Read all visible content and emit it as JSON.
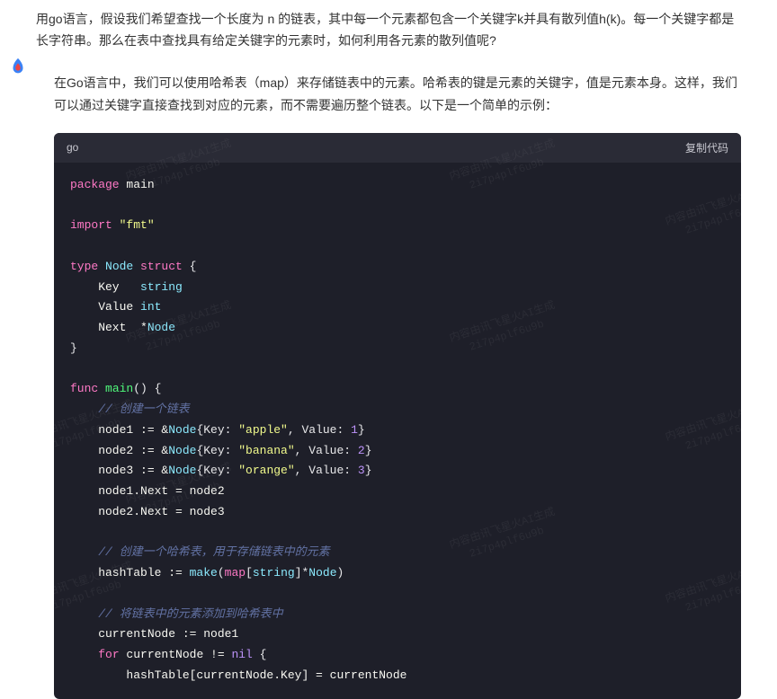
{
  "header": {
    "question": "用go语言，假设我们希望查找一个长度为 n 的链表，其中每一个元素都包含一个关键字k并具有散列值h(k)。每一个关键字都是长字符串。那么在表中查找具有给定关键字的元素时，如何利用各元素的散列值呢?"
  },
  "response": {
    "intro": "在Go语言中，我们可以使用哈希表（map）来存储链表中的元素。哈希表的键是元素的关键字，值是元素本身。这样，我们可以通过关键字直接查找到对应的元素，而不需要遍历整个链表。以下是一个简单的示例："
  },
  "code": {
    "lang": "go",
    "copy_label": "复制代码",
    "lines": {
      "l1_kw": "package",
      "l1_ident": " main",
      "l2_kw": "import",
      "l2_str": " \"fmt\"",
      "l3_kw": "type",
      "l3_name": " Node ",
      "l3_struct": "struct",
      "l3_brace": " {",
      "l4": "    Key   ",
      "l4_type": "string",
      "l5": "    Value ",
      "l5_type": "int",
      "l6": "    Next  *",
      "l6_type": "Node",
      "l7": "}",
      "l8_kw": "func",
      "l8_name": " main",
      "l8_paren": "() {",
      "l9_comment": "    // 创建一个链表",
      "l10a": "    node1 := &",
      "l10b": "Node",
      "l10c": "{Key: ",
      "l10d": "\"apple\"",
      "l10e": ", Value: ",
      "l10f": "1",
      "l10g": "}",
      "l11a": "    node2 := &",
      "l11b": "Node",
      "l11c": "{Key: ",
      "l11d": "\"banana\"",
      "l11e": ", Value: ",
      "l11f": "2",
      "l11g": "}",
      "l12a": "    node3 := &",
      "l12b": "Node",
      "l12c": "{Key: ",
      "l12d": "\"orange\"",
      "l12e": ", Value: ",
      "l12f": "3",
      "l12g": "}",
      "l13": "    node1.Next = node2",
      "l14": "    node2.Next = node3",
      "l15_comment": "    // 创建一个哈希表，用于存储链表中的元素",
      "l16a": "    hashTable := ",
      "l16b": "make",
      "l16c": "(",
      "l16d": "map",
      "l16e": "[",
      "l16f": "string",
      "l16g": "]*",
      "l16h": "Node",
      "l16i": ")",
      "l17_comment": "    // 将链表中的元素添加到哈希表中",
      "l18": "    currentNode := node1",
      "l19a": "    ",
      "l19b": "for",
      "l19c": " currentNode != ",
      "l19d": "nil",
      "l19e": " {",
      "l20": "        hashTable[currentNode.Key] = currentNode"
    }
  },
  "watermark": {
    "text1": "内容由讯飞星火AI生成",
    "text2": "2i7p4plf6u9b"
  }
}
